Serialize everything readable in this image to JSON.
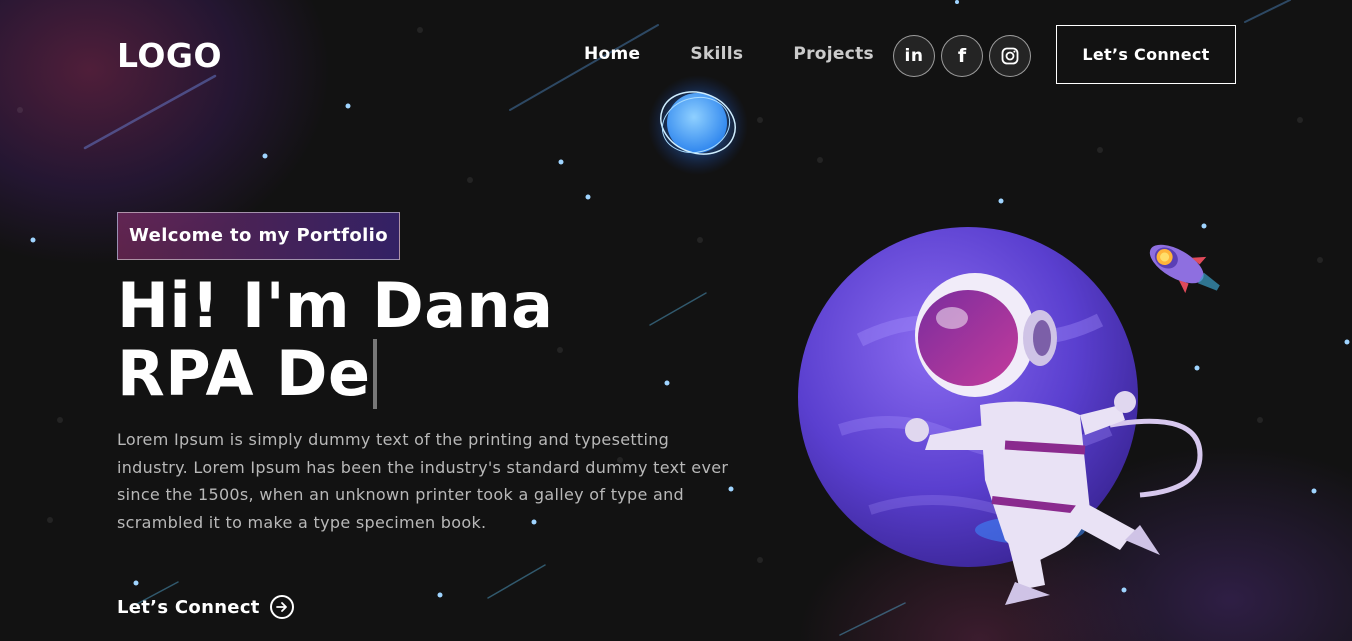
{
  "brand": {
    "logo": "LOGO"
  },
  "nav": {
    "items": [
      {
        "label": "Home",
        "active": true
      },
      {
        "label": "Skills",
        "active": false
      },
      {
        "label": "Projects",
        "active": false
      }
    ],
    "socials": [
      {
        "name": "linkedin-icon",
        "glyph": "in"
      },
      {
        "name": "facebook-icon",
        "glyph": "f"
      },
      {
        "name": "instagram-icon",
        "glyph": ""
      }
    ],
    "connect_label": "Let’s Connect"
  },
  "hero": {
    "tagline": "Welcome to my Portfolio",
    "greeting": "Hi! I'm Dana",
    "role_typed": "RPA De",
    "description": "Lorem Ipsum is simply dummy text of the printing and typesetting industry. Lorem Ipsum has been the industry's standard dummy text ever since the 1500s, when an unknown printer took a galley of type and scrambled it to make a type specimen book.",
    "cta_label": "Let’s Connect"
  },
  "colors": {
    "background": "#121212",
    "accent_pink": "#AA367C",
    "accent_violet": "#4A2FBD",
    "planet": "#6a4fd8"
  }
}
